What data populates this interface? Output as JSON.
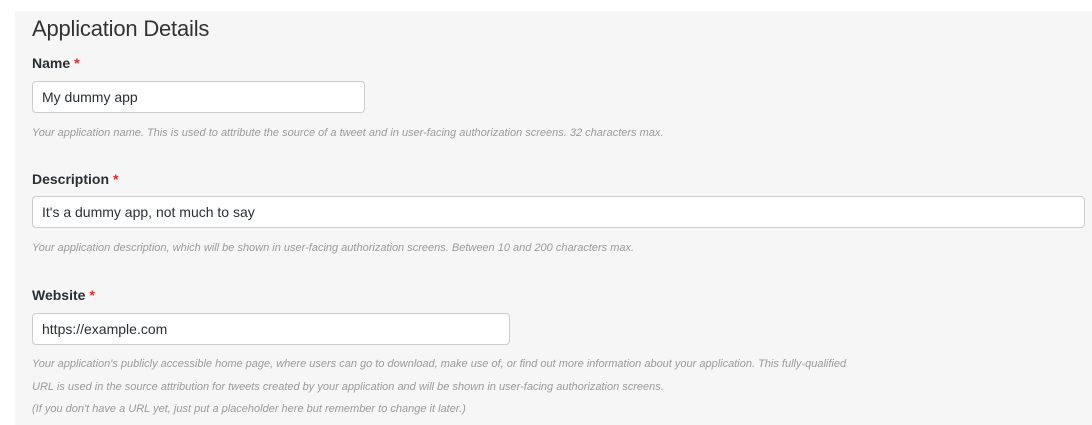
{
  "section": {
    "title": "Application Details"
  },
  "required_marker": "*",
  "fields": {
    "name": {
      "label": "Name",
      "value": "My dummy app",
      "help": "Your application name. This is used to attribute the source of a tweet and in user-facing authorization screens. 32 characters max."
    },
    "description": {
      "label": "Description",
      "value": "It's a dummy app, not much to say",
      "help": "Your application description, which will be shown in user-facing authorization screens. Between 10 and 200 characters max."
    },
    "website": {
      "label": "Website",
      "value": "https://example.com",
      "help_line1": "Your application's publicly accessible home page, where users can go to download, make use of, or find out more information about your application. This fully-qualified",
      "help_line2": "URL is used in the source attribution for tweets created by your application and will be shown in user-facing authorization screens.",
      "help_line3": "(If you don't have a URL yet, just put a placeholder here but remember to change it later.)"
    }
  }
}
